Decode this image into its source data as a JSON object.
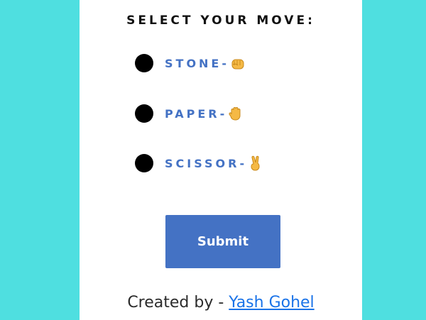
{
  "heading": "SELECT YOUR MOVE:",
  "options": [
    {
      "label": "STONE-",
      "icon": "fist-emoji-icon"
    },
    {
      "label": "PAPER-",
      "icon": "raised-hand-emoji-icon"
    },
    {
      "label": "SCISSOR-",
      "icon": "victory-hand-emoji-icon"
    }
  ],
  "submit_label": "Submit",
  "footer": {
    "prefix": "Created by - ",
    "author": "Yash Gohel"
  },
  "colors": {
    "background": "#4fdfe0",
    "accent": "#4472c4",
    "link": "#1a73e8"
  }
}
